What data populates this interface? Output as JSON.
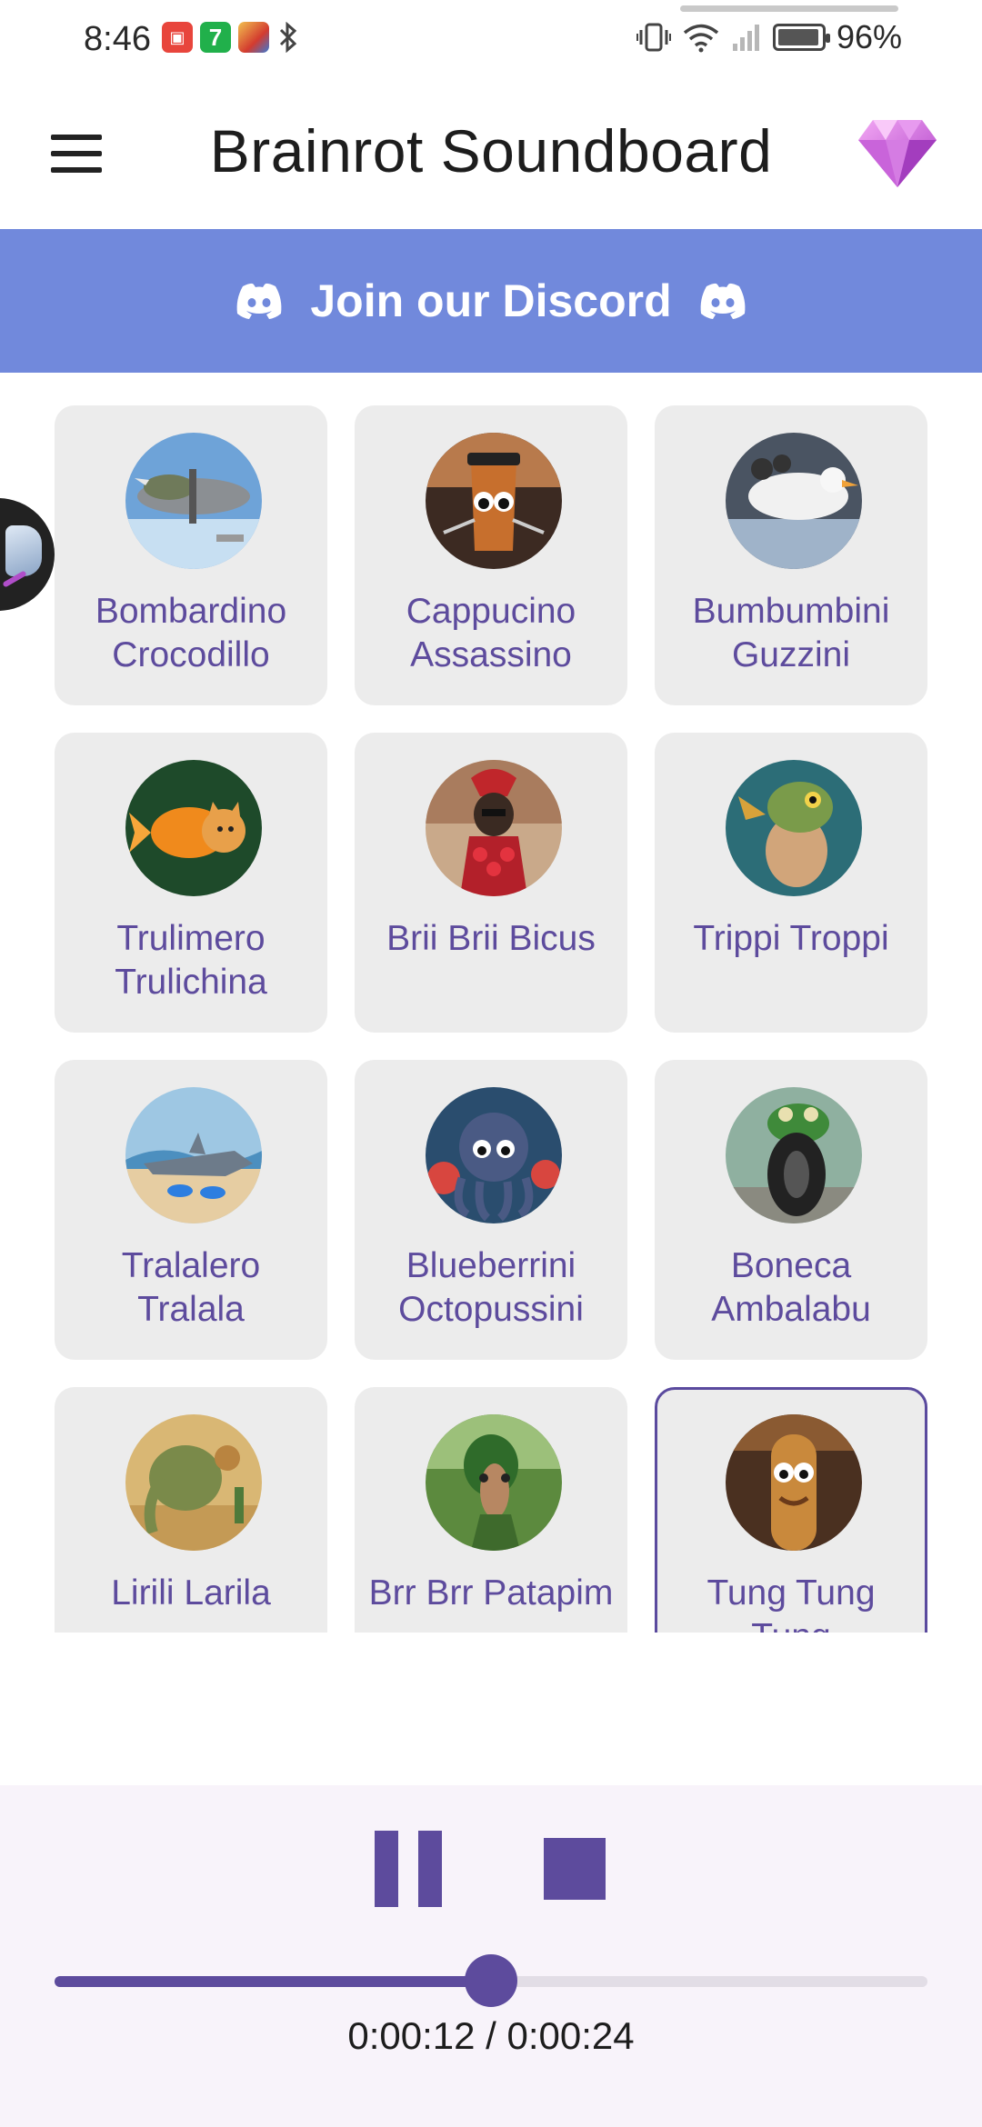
{
  "status_bar": {
    "time": "8:46",
    "battery_percent": "96%",
    "battery_level": 0.96,
    "icons": [
      "huawei-app-icon",
      "seven-app-icon",
      "game-app-icon",
      "bluetooth-icon",
      "vibrate-icon",
      "wifi-icon",
      "signal-icon",
      "battery-icon"
    ]
  },
  "app_bar": {
    "title": "Brainrot Soundboard",
    "menu_icon": "hamburger-menu-icon",
    "premium_icon": "diamond-icon"
  },
  "discord_banner": {
    "label": "Join our Discord",
    "color": "#7189dc"
  },
  "sounds": [
    {
      "name": "Bombardino Crocodillo",
      "thumb": "crocodile-bomber-plane"
    },
    {
      "name": "Cappucino Assassino",
      "thumb": "coffee-cup-assassin"
    },
    {
      "name": "Bumbumbini Guzzini",
      "thumb": "goose-jet"
    },
    {
      "name": "Trulimero Trulichina",
      "thumb": "goldfish-cat"
    },
    {
      "name": "Brii Brii Bicus",
      "thumb": "roman-sloth-strawberries"
    },
    {
      "name": "Trippi Troppi",
      "thumb": "fish-frog-creature"
    },
    {
      "name": "Tralalero Tralala",
      "thumb": "shark-in-sneakers"
    },
    {
      "name": "Blueberrini Octopussini",
      "thumb": "blueberry-octopus"
    },
    {
      "name": "Boneca Ambalabu",
      "thumb": "frog-tire"
    },
    {
      "name": "Lirili Larila",
      "thumb": "cactus-elephant"
    },
    {
      "name": "Brr Brr Patapim",
      "thumb": "tree-nose-man"
    },
    {
      "name": "Tung Tung Tung",
      "thumb": "wooden-log-man",
      "selected": true
    }
  ],
  "player": {
    "pause_icon": "pause-icon",
    "stop_icon": "stop-icon",
    "time_display": "0:00:12 / 0:00:24",
    "progress": 0.5,
    "accent": "#5d4b9d"
  }
}
